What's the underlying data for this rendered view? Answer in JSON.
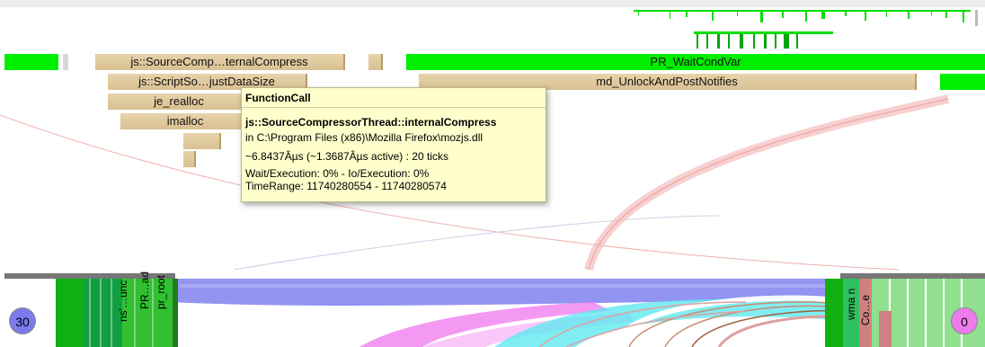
{
  "flame": {
    "row1": {
      "bar1": "js::SourceComp…ternalCompress",
      "bar2": "PR_WaitCondVar"
    },
    "row2": {
      "bar1": "js::ScriptSo…justDataSize",
      "bar2": "md_UnlockAndPostNotifies"
    },
    "row3": {
      "bar1": "je_realloc"
    },
    "row4": {
      "bar1": "imalloc"
    }
  },
  "tooltip": {
    "title": "FunctionCall",
    "function": "js::SourceCompressorThread::internalCompress",
    "module": "in C:\\Program Files (x86)\\Mozilla Firefox\\mozjs.dll",
    "timing": "~6.8437Âµs (~1.3687Âµs active) : 20 ticks",
    "wait": "Wait/Execution: 0% - Io/Execution: 0%",
    "range": "TimeRange: 11740280554 - 11740280574"
  },
  "ring": {
    "left_badge": "30",
    "right_badge": "0",
    "left_labels": [
      "pr_root",
      "PR…ad",
      "ns'…unc"
    ],
    "right_labels": [
      "wma n",
      "Co…e"
    ]
  },
  "colors": {
    "tan": "#dcc698",
    "green": "#00ee00",
    "tooltip_bg": "#ffffcc",
    "left_badge": "#7b7bee",
    "right_badge": "#ee7bee"
  }
}
